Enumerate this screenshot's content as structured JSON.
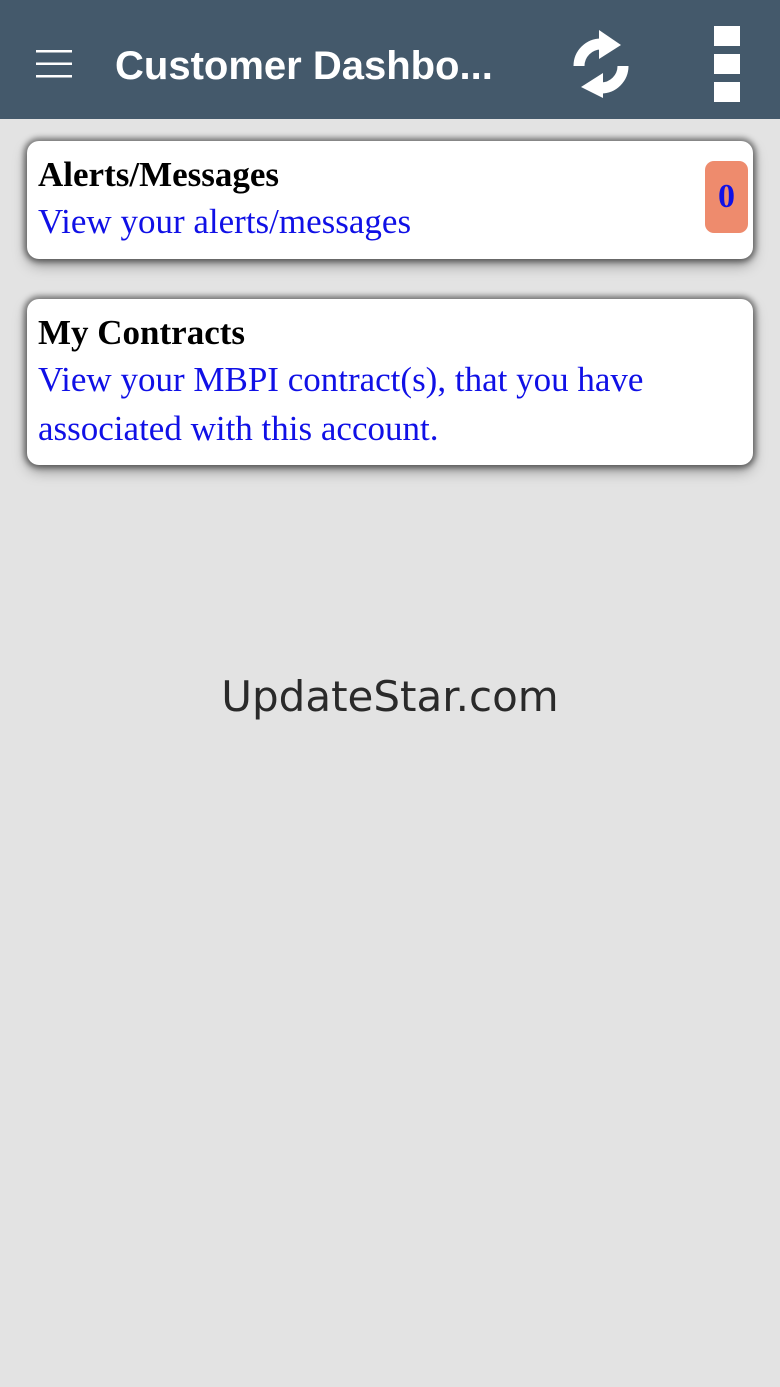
{
  "app_bar": {
    "title": "Customer Dashbo...",
    "background_color": "#44596b",
    "menu_icon": "hamburger-menu-icon",
    "refresh_icon": "refresh-icon",
    "overflow_icon": "more-vertical-icon"
  },
  "cards": {
    "alerts": {
      "title": "Alerts/Messages",
      "description": "View your alerts/messages",
      "badge_count": "0",
      "badge_color": "#ee8b6d"
    },
    "contracts": {
      "title": "My Contracts",
      "description": "View your MBPI contract(s), that you have associated with this account."
    }
  },
  "link_color": "#1010e6",
  "watermark": "UpdateStar.com"
}
